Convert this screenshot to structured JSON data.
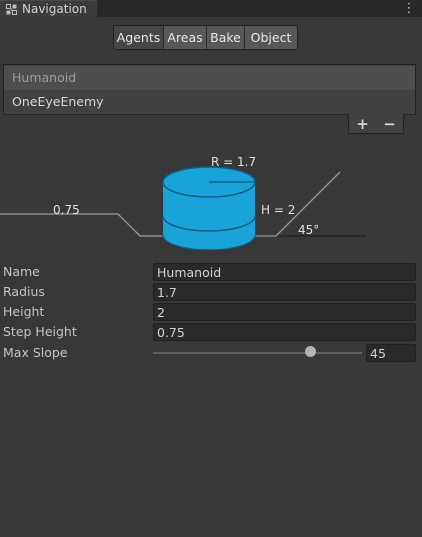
{
  "window": {
    "tab_title": "Navigation",
    "tab_icon": "navigation-icon",
    "menu_icon": "kebab-menu-icon"
  },
  "toolbar": {
    "tabs": [
      {
        "label": "Agents",
        "active": true
      },
      {
        "label": "Areas",
        "active": false
      },
      {
        "label": "Bake",
        "active": false
      },
      {
        "label": "Object",
        "active": false
      }
    ]
  },
  "agents": {
    "items": [
      {
        "label": "Humanoid",
        "selected": true
      },
      {
        "label": "OneEyeEnemy",
        "selected": false
      }
    ],
    "add_label": "+",
    "remove_label": "−"
  },
  "diagram": {
    "radius_label": "R = 1.7",
    "height_label": "H = 2",
    "step_label": "0.75",
    "slope_label": "45°",
    "cylinder_color": "#1aa3d8"
  },
  "properties": {
    "name_label": "Name",
    "name_value": "Humanoid",
    "radius_label": "Radius",
    "radius_value": "1.7",
    "height_label": "Height",
    "height_value": "2",
    "step_height_label": "Step Height",
    "step_height_value": "0.75",
    "max_slope_label": "Max Slope",
    "max_slope_value": "45",
    "max_slope_fraction": 0.75
  }
}
